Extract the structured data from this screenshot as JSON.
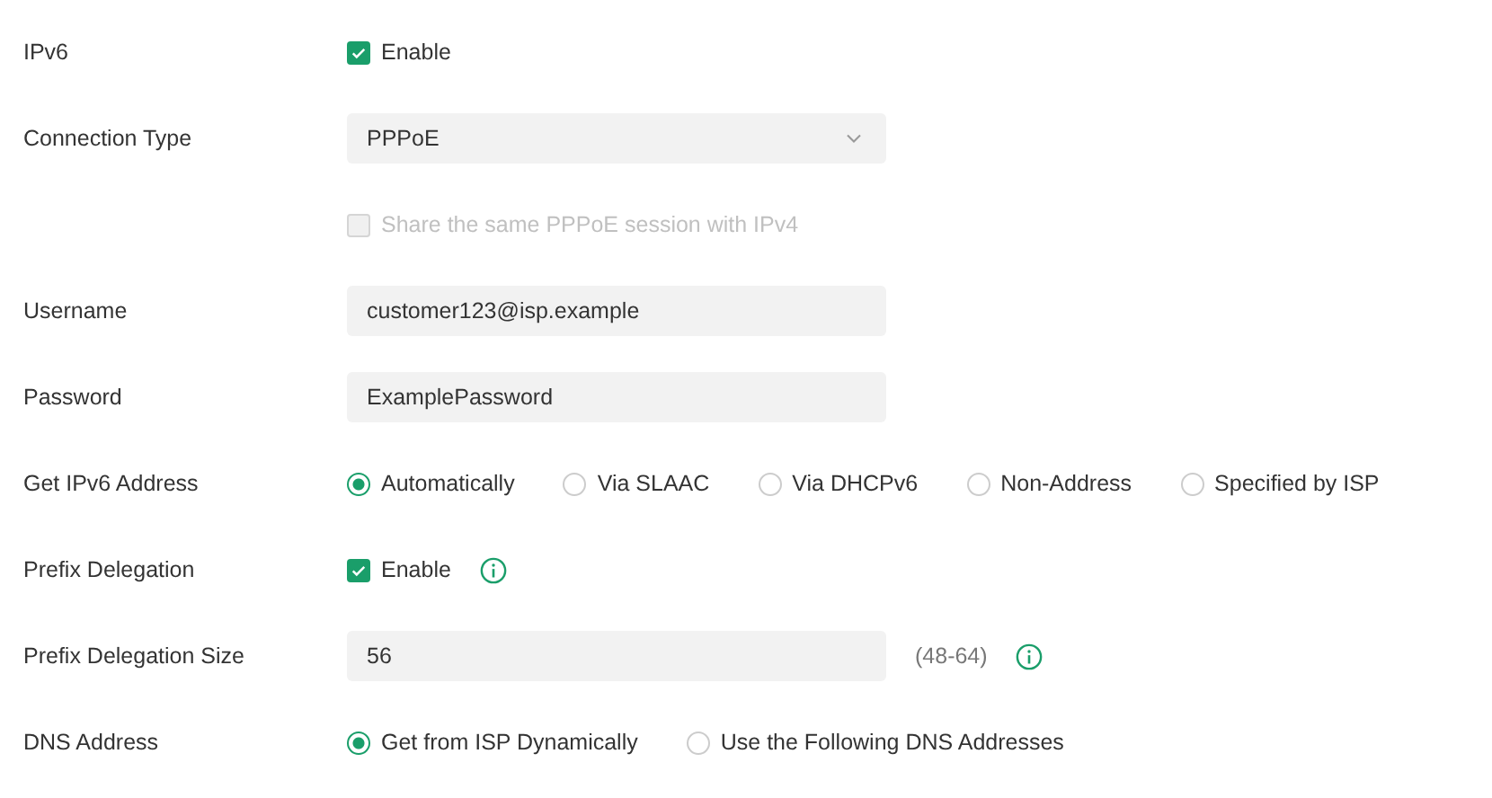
{
  "rows": [
    {
      "label": "IPv6",
      "kind": "checkbox",
      "text": "Enable",
      "checked": true,
      "disabled": false,
      "info": false
    },
    {
      "label": "Connection Type",
      "kind": "select",
      "value": "PPPoE"
    },
    {
      "kind": "checkbox",
      "text": "Share the same PPPoE session with IPv4",
      "checked": false,
      "disabled": true,
      "info": false
    },
    {
      "label": "Username",
      "kind": "text",
      "value": "customer123@isp.example",
      "info": false
    },
    {
      "label": "Password",
      "kind": "text",
      "value": "ExamplePassword",
      "info": false
    },
    {
      "label": "Get IPv6 Address",
      "kind": "radio",
      "options": [
        {
          "label": "Automatically",
          "selected": true
        },
        {
          "label": "Via SLAAC",
          "selected": false
        },
        {
          "label": "Via DHCPv6",
          "selected": false
        },
        {
          "label": "Non-Address",
          "selected": false
        },
        {
          "label": "Specified by ISP",
          "selected": false
        }
      ]
    },
    {
      "label": "Prefix Delegation",
      "kind": "checkbox",
      "text": "Enable",
      "checked": true,
      "disabled": false,
      "info": true
    },
    {
      "label": "Prefix Delegation Size",
      "kind": "text",
      "value": "56",
      "hint": "(48-64)",
      "info": true
    },
    {
      "label": "DNS Address",
      "kind": "radio",
      "options": [
        {
          "label": "Get from ISP Dynamically",
          "selected": true
        },
        {
          "label": "Use the Following DNS Addresses",
          "selected": false
        }
      ]
    }
  ]
}
